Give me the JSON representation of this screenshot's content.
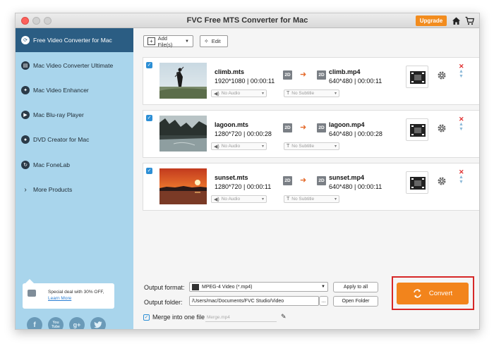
{
  "window": {
    "title": "FVC Free MTS Converter for Mac"
  },
  "header": {
    "upgrade_label": "Upgrade",
    "home_icon": "home-icon",
    "cart_icon": "cart-icon"
  },
  "sidebar": {
    "items": [
      {
        "label": "Free Video Converter for Mac",
        "icon": "refresh-icon",
        "active": true
      },
      {
        "label": "Mac Video Converter Ultimate",
        "icon": "film-icon"
      },
      {
        "label": "Mac Video Enhancer",
        "icon": "enhance-icon"
      },
      {
        "label": "Mac Blu-ray Player",
        "icon": "play-icon"
      },
      {
        "label": "DVD Creator for Mac",
        "icon": "disc-icon"
      },
      {
        "label": "Mac FoneLab",
        "icon": "phone-icon"
      },
      {
        "label": "More Products",
        "icon": "chevron-right-icon"
      }
    ],
    "promo": {
      "text": "Special deal with 30% OFF,",
      "link": "Learn More"
    },
    "social": [
      "f",
      "You Tube",
      "g+",
      "twitter-icon"
    ]
  },
  "toolbar": {
    "add_files_label": "Add File(s)",
    "edit_label": "Edit"
  },
  "files": [
    {
      "source_name": "climb.mts",
      "source_meta": "1920*1080 | 00:00:11",
      "badge": "2D",
      "output_name": "climb.mp4",
      "output_meta": "640*480 | 00:00:11",
      "audio": "No Audio",
      "subtitle": "No Subtitle",
      "checked": true
    },
    {
      "source_name": "lagoon.mts",
      "source_meta": "1280*720 | 00:00:28",
      "badge": "2D",
      "output_name": "lagoon.mp4",
      "output_meta": "640*480 | 00:00:28",
      "audio": "No Audio",
      "subtitle": "No Subtitle",
      "checked": true
    },
    {
      "source_name": "sunset.mts",
      "source_meta": "1280*720 | 00:00:11",
      "badge": "2D",
      "output_name": "sunset.mp4",
      "output_meta": "640*480 | 00:00:11",
      "audio": "No Audio",
      "subtitle": "No Subtitle",
      "checked": true
    }
  ],
  "bottom": {
    "output_format_label": "Output format:",
    "output_format_value": "MPEG-4 Video (*.mp4)",
    "apply_all_label": "Apply to all",
    "output_folder_label": "Output folder:",
    "output_folder_value": "/Users/mac/Documents/FVC Studio/Video",
    "browse_label": "...",
    "open_folder_label": "Open Folder",
    "merge_label": "Merge into one file",
    "merge_placeholder": "Merge.mp4",
    "convert_label": "Convert"
  },
  "colors": {
    "accent": "#f2841c",
    "sidebar_bg": "#a9d5ec",
    "sidebar_active": "#2b5d83",
    "highlight": "#d62727"
  }
}
